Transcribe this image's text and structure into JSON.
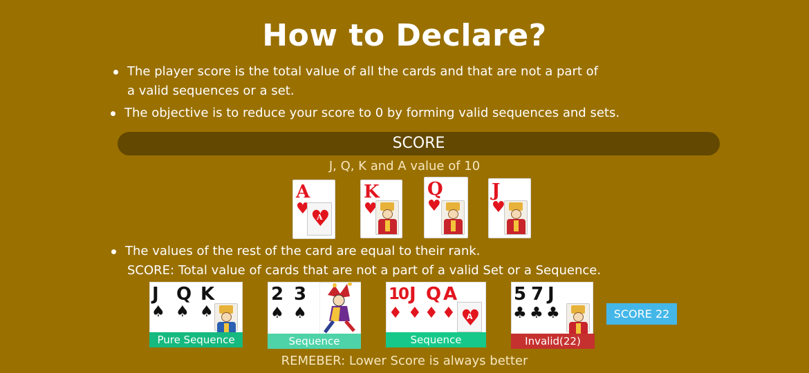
{
  "title": "How to Declare?",
  "bullets": [
    {
      "line1": "The player score is the total value of all the cards and that are not a part of",
      "line2": "a valid sequences or a set."
    },
    {
      "line1": "The objective is to reduce your score to 0 by forming valid sequences and sets."
    },
    {
      "line1": "The values of the rest of the card are equal to their rank.",
      "line2": "SCORE: Total value of cards that are not a part of a valid Set or a Sequence."
    }
  ],
  "score_header": "SCORE",
  "face_value_note": "J, Q, K and A value of 10",
  "face_cards": [
    {
      "rank": "A",
      "suit": "♥"
    },
    {
      "rank": "K",
      "suit": "♥"
    },
    {
      "rank": "Q",
      "suit": "♥"
    },
    {
      "rank": "J",
      "suit": "♥"
    }
  ],
  "hands": [
    {
      "cards": [
        "J",
        "Q",
        "K"
      ],
      "suit": "♠",
      "label": "Pure Sequence",
      "label_color": "#16b980"
    },
    {
      "cards": [
        "2",
        "3"
      ],
      "suit": "♠",
      "extra": "joker",
      "label": "Sequence",
      "label_color": "#4ed3a8"
    },
    {
      "cards": [
        "10",
        "J",
        "Q",
        "A"
      ],
      "suit": "♦",
      "label": "Sequence",
      "label_color": "#16c98a"
    },
    {
      "cards": [
        "5",
        "7",
        "J"
      ],
      "suit": "♣",
      "label": "Invalid(22)",
      "label_color": "#c5312f"
    }
  ],
  "total_score": "SCORE 22",
  "remember": "REMEBER: Lower Score is always better",
  "colors": {
    "background": "#9a7000",
    "score_bar": "#624800",
    "score_badge": "#44b7e8",
    "suit_red": "#e2151e"
  }
}
